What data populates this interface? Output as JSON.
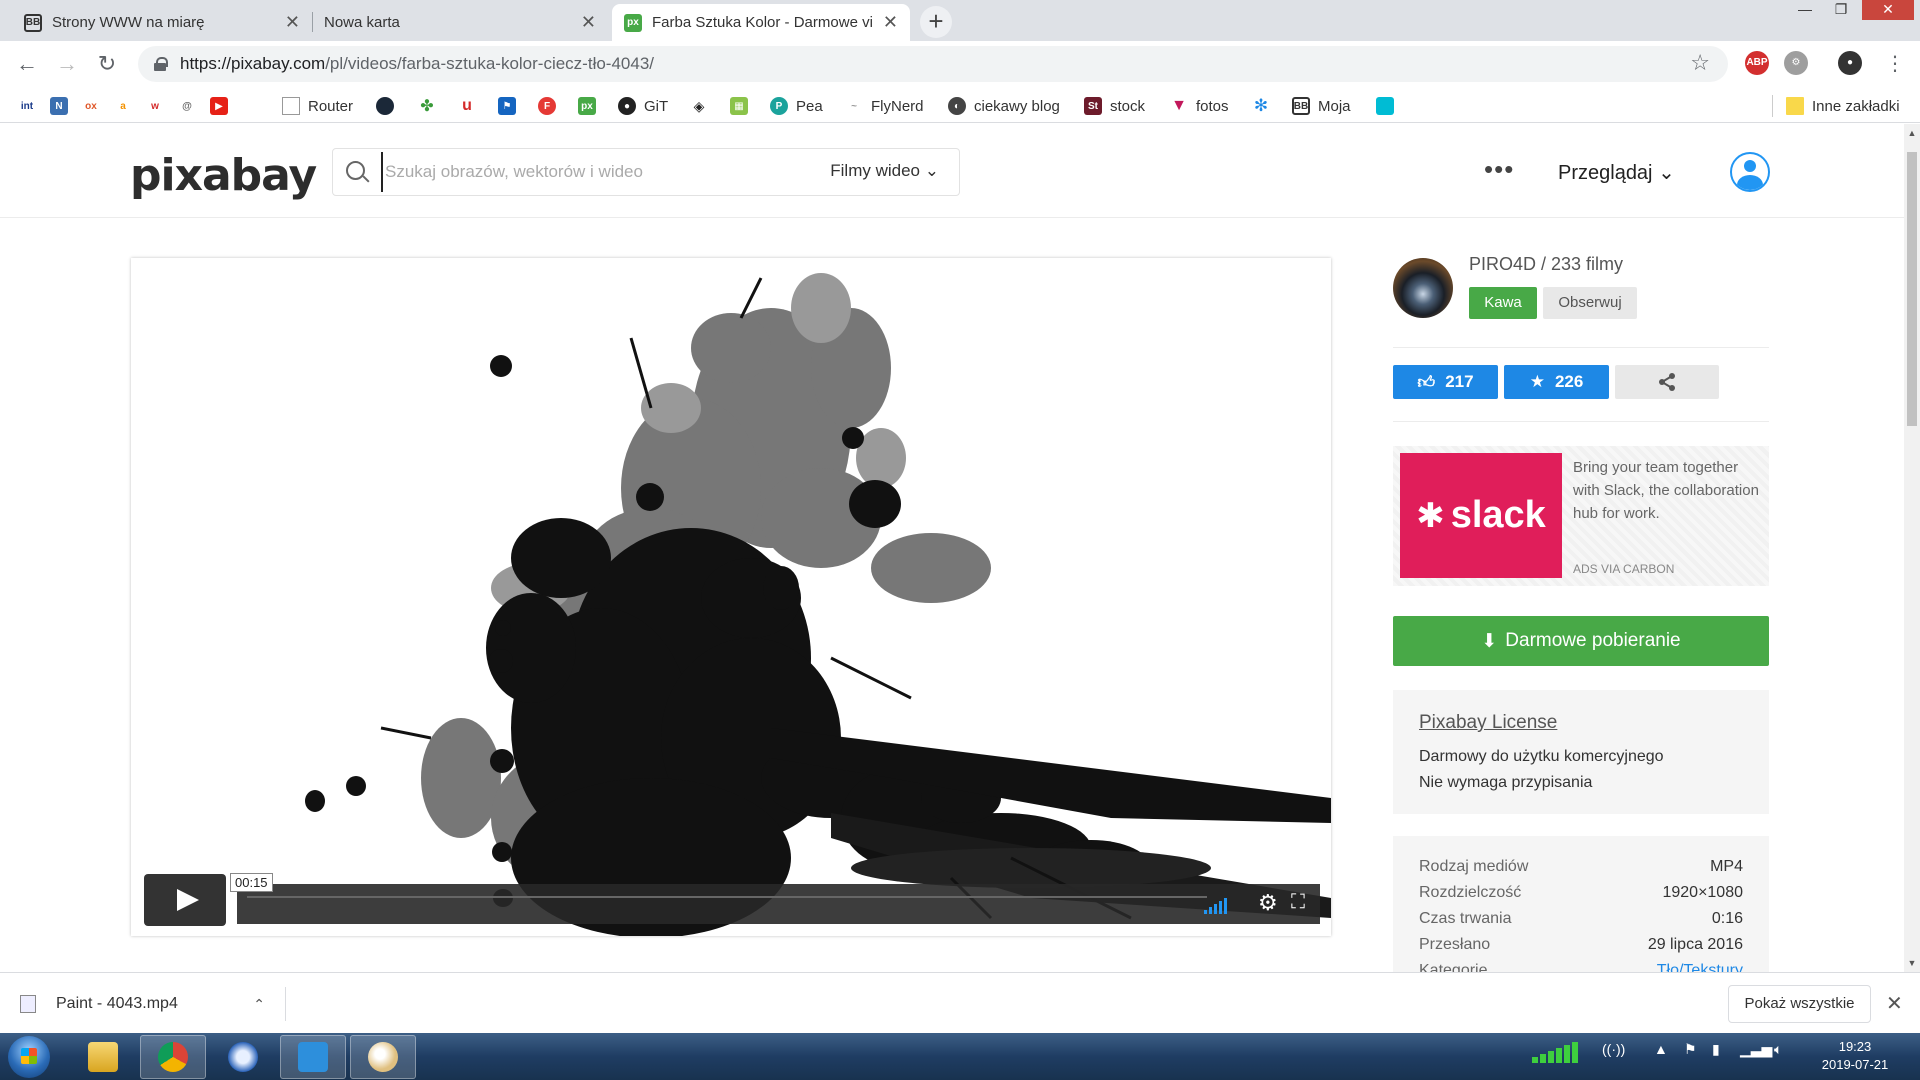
{
  "browser": {
    "tabs": [
      {
        "label": "Strony WWW na miarę",
        "active": false
      },
      {
        "label": "Nowa karta",
        "active": false
      },
      {
        "label": "Farba Sztuka Kolor - Darmowe vi",
        "active": true
      }
    ],
    "url_host": "https://pixabay.com",
    "url_path": "/pl/videos/farba-sztuka-kolor-ciecz-tło-4043/",
    "extensions": [
      "ABP",
      "gear",
      "avatar"
    ],
    "bookmarks": [
      "Router",
      "GiT",
      "Pea",
      "FlyNerd",
      "ciekawy blog",
      "stock",
      "fotos",
      "Moja",
      "Inne zakładki"
    ],
    "bookmark_icons": [
      {
        "name": "int-icon",
        "glyph": "int",
        "bg": "#ffffff",
        "fg": "#1a3a8a"
      },
      {
        "name": "bookmark-n-icon",
        "glyph": "N",
        "bg": "#3b6fb0",
        "fg": "#ffffff"
      },
      {
        "name": "olx-icon",
        "glyph": "ox",
        "bg": "#ffffff",
        "fg": "#e0582a"
      },
      {
        "name": "amazon-icon",
        "glyph": "a",
        "bg": "#ffffff",
        "fg": "#f39200"
      },
      {
        "name": "wykop-icon",
        "glyph": "w",
        "bg": "#ffffff",
        "fg": "#d42a2a"
      },
      {
        "name": "at-icon",
        "glyph": "@",
        "bg": "#ffffff",
        "fg": "#666666"
      },
      {
        "name": "youtube-icon",
        "glyph": "▶",
        "bg": "#e62117",
        "fg": "#ffffff"
      }
    ]
  },
  "pixabay": {
    "logo": "pixabay",
    "search_placeholder": "Szukaj obrazów, wektorów i wideo",
    "search_filter": "Filmy wideo",
    "more": "•••",
    "browse": "Przeglądaj",
    "player": {
      "time": "00:15"
    },
    "author": "PIRO4D / 233 filmy",
    "btn_kawa": "Kawa",
    "btn_follow": "Obserwuj",
    "likes": "217",
    "favorites": "226",
    "ad": {
      "brand": "slack",
      "text": "Bring your team together with Slack, the collaboration hub for work.",
      "via": "ADS VIA CARBON"
    },
    "download": "Darmowe pobieranie",
    "license": {
      "title": "Pixabay License",
      "line1": "Darmowy do użytku komercyjnego",
      "line2": "Nie wymaga przypisania"
    },
    "details": [
      {
        "label": "Rodzaj mediów",
        "value": "MP4"
      },
      {
        "label": "Rozdzielczość",
        "value": "1920×1080"
      },
      {
        "label": "Czas trwania",
        "value": "0:16"
      },
      {
        "label": "Przesłano",
        "value": "29 lipca 2016"
      },
      {
        "label": "Kategorie",
        "value": "Tło/Tekstury"
      }
    ]
  },
  "downloads": {
    "file": "Paint - 4043.mp4",
    "show_all": "Pokaż wszystkie"
  },
  "taskbar": {
    "time": "19:23",
    "date": "2019-07-21"
  },
  "colors": {
    "accent_green": "#48a947",
    "accent_blue": "#1e88e5",
    "slack": "#e01e5a"
  }
}
